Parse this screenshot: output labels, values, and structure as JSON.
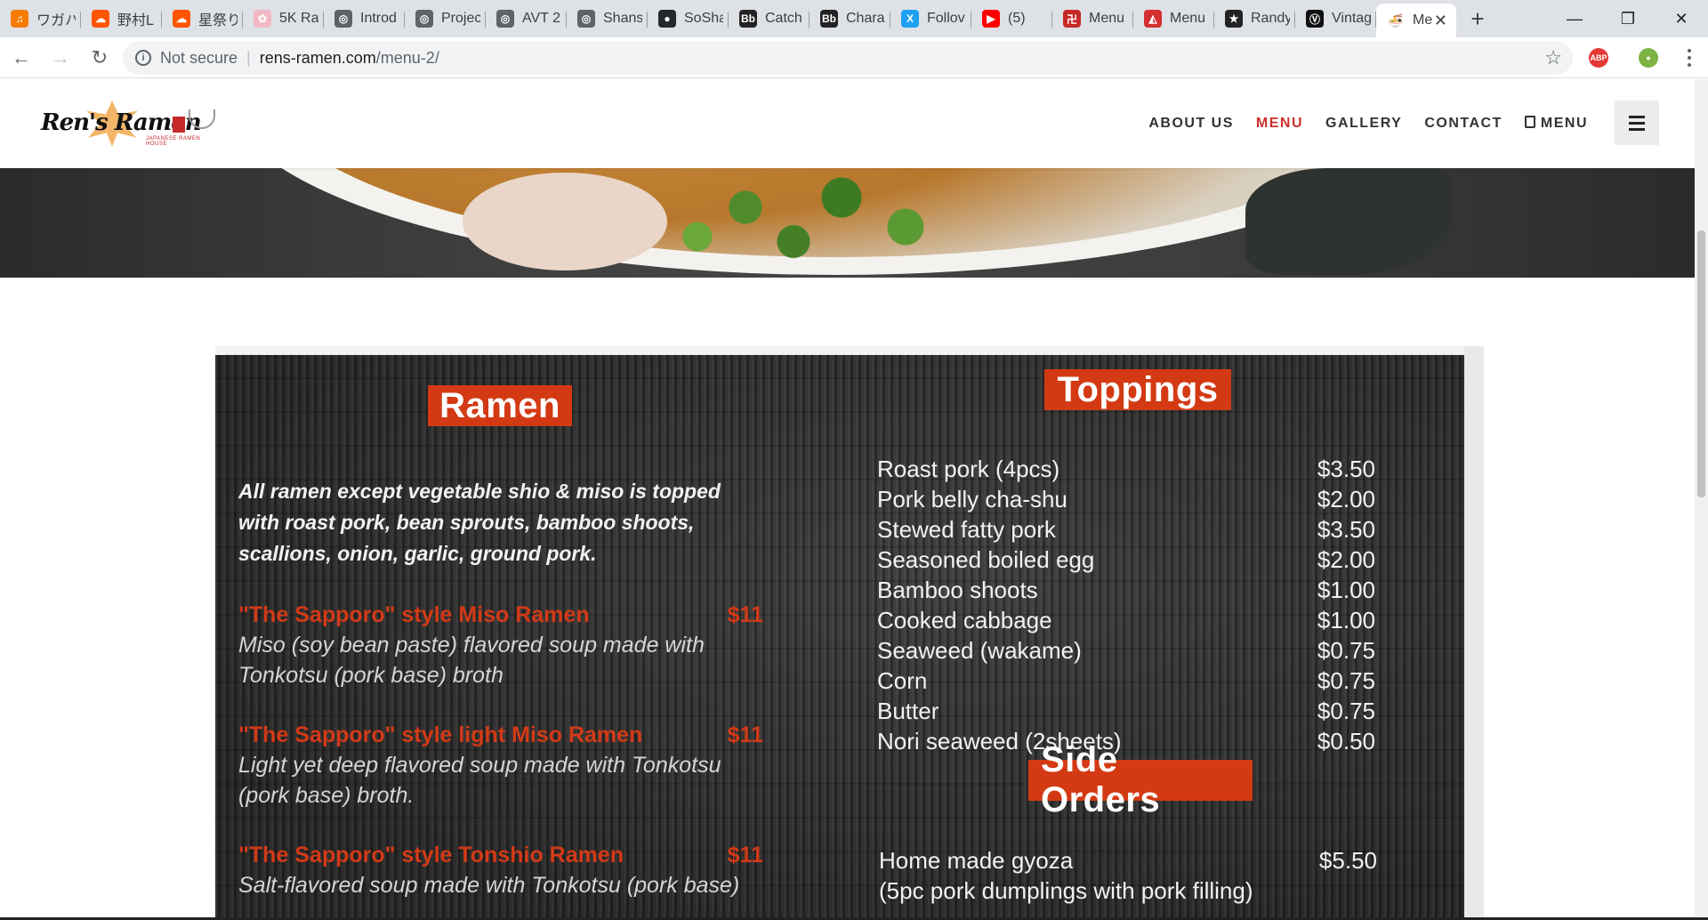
{
  "browser": {
    "tabs": [
      {
        "title": "ワガハ",
        "icon": "headphones-icon",
        "color": "#f57c00",
        "glyph": "♫"
      },
      {
        "title": "野村L",
        "icon": "soundcloud-icon",
        "color": "#ff5500",
        "glyph": "☁"
      },
      {
        "title": "星祭り",
        "icon": "soundcloud-icon",
        "color": "#ff5500",
        "glyph": "☁"
      },
      {
        "title": "5K Ra",
        "icon": "anime-icon",
        "color": "#f2b8c6",
        "glyph": "✿"
      },
      {
        "title": "Introd",
        "icon": "globe-icon",
        "color": "#5f6368",
        "glyph": "◎"
      },
      {
        "title": "Projec",
        "icon": "globe-icon",
        "color": "#5f6368",
        "glyph": "◎"
      },
      {
        "title": "AVT 2",
        "icon": "globe-icon",
        "color": "#5f6368",
        "glyph": "◎"
      },
      {
        "title": "Shansi",
        "icon": "globe-icon",
        "color": "#5f6368",
        "glyph": "◎"
      },
      {
        "title": "SoSha",
        "icon": "github-icon",
        "color": "#24292e",
        "glyph": "●"
      },
      {
        "title": "Catch",
        "icon": "blackboard-icon",
        "color": "#222222",
        "glyph": "Bb"
      },
      {
        "title": "Chara",
        "icon": "blackboard-icon",
        "color": "#222222",
        "glyph": "Bb"
      },
      {
        "title": "Follov",
        "icon": "x-icon",
        "color": "#1da1f2",
        "glyph": "X"
      },
      {
        "title": "(5)",
        "icon": "youtube-icon",
        "color": "#ff0000",
        "glyph": "▶"
      },
      {
        "title": "Menu",
        "icon": "restaurant-icon",
        "color": "#c62828",
        "glyph": "卍"
      },
      {
        "title": "Menu",
        "icon": "restaurant-icon",
        "color": "#d32f2f",
        "glyph": "◭"
      },
      {
        "title": "Randy",
        "icon": "star-circle-icon",
        "color": "#222222",
        "glyph": "★"
      },
      {
        "title": "Vintag",
        "icon": "vintage-icon",
        "color": "#111111",
        "glyph": "Ⓥ"
      }
    ],
    "active_tab": {
      "title": "Me",
      "icon": "ramen-icon"
    },
    "address": {
      "security": "Not secure",
      "host": "rens-ramen.com",
      "path": "/menu-2/"
    }
  },
  "site": {
    "logo_alt": "Ren's Ramen",
    "logo_tagline": "JAPANESE RAMEN HOUSE",
    "nav": [
      "ABOUT US",
      "MENU",
      "GALLERY",
      "CONTACT",
      "MENU"
    ],
    "active_nav": "MENU"
  },
  "menu": {
    "ramen": {
      "heading": "Ramen",
      "intro": "All ramen except vegetable shio & miso is topped with roast pork, bean sprouts, bamboo shoots, scallions, onion, garlic, ground pork.",
      "items": [
        {
          "name": "\"The Sapporo\" style Miso Ramen",
          "price": "$11",
          "desc": "Miso (soy bean paste) flavored soup made with Tonkotsu (pork base) broth"
        },
        {
          "name": "\"The Sapporo\" style light Miso Ramen",
          "price": "$11",
          "desc": "Light yet deep flavored soup made with Tonkotsu (pork base) broth."
        },
        {
          "name": "\"The Sapporo\" style Tonshio Ramen",
          "price": "$11",
          "desc": "Salt-flavored soup made with Tonkotsu (pork base)"
        }
      ]
    },
    "toppings": {
      "heading": "Toppings",
      "items": [
        {
          "name": "Roast pork (4pcs)",
          "price": "$3.50"
        },
        {
          "name": "Pork belly cha-shu",
          "price": "$2.00"
        },
        {
          "name": "Stewed fatty pork",
          "price": "$3.50"
        },
        {
          "name": "Seasoned boiled egg",
          "price": "$2.00"
        },
        {
          "name": "Bamboo shoots",
          "price": "$1.00"
        },
        {
          "name": "Cooked cabbage",
          "price": "$1.00"
        },
        {
          "name": "Seaweed (wakame)",
          "price": "$0.75"
        },
        {
          "name": "Corn",
          "price": "$0.75"
        },
        {
          "name": "Butter",
          "price": "$0.75"
        },
        {
          "name": "Nori seaweed (2sheets)",
          "price": "$0.50"
        }
      ]
    },
    "side_orders": {
      "heading": "Side Orders",
      "items": [
        {
          "name": "Home made gyoza",
          "price": "$5.50",
          "note": "(5pc pork dumplings with pork filling)"
        }
      ]
    }
  },
  "colors": {
    "accent": "#d33a14",
    "nav_active": "#c9302c",
    "board": "#2b2b2b"
  }
}
